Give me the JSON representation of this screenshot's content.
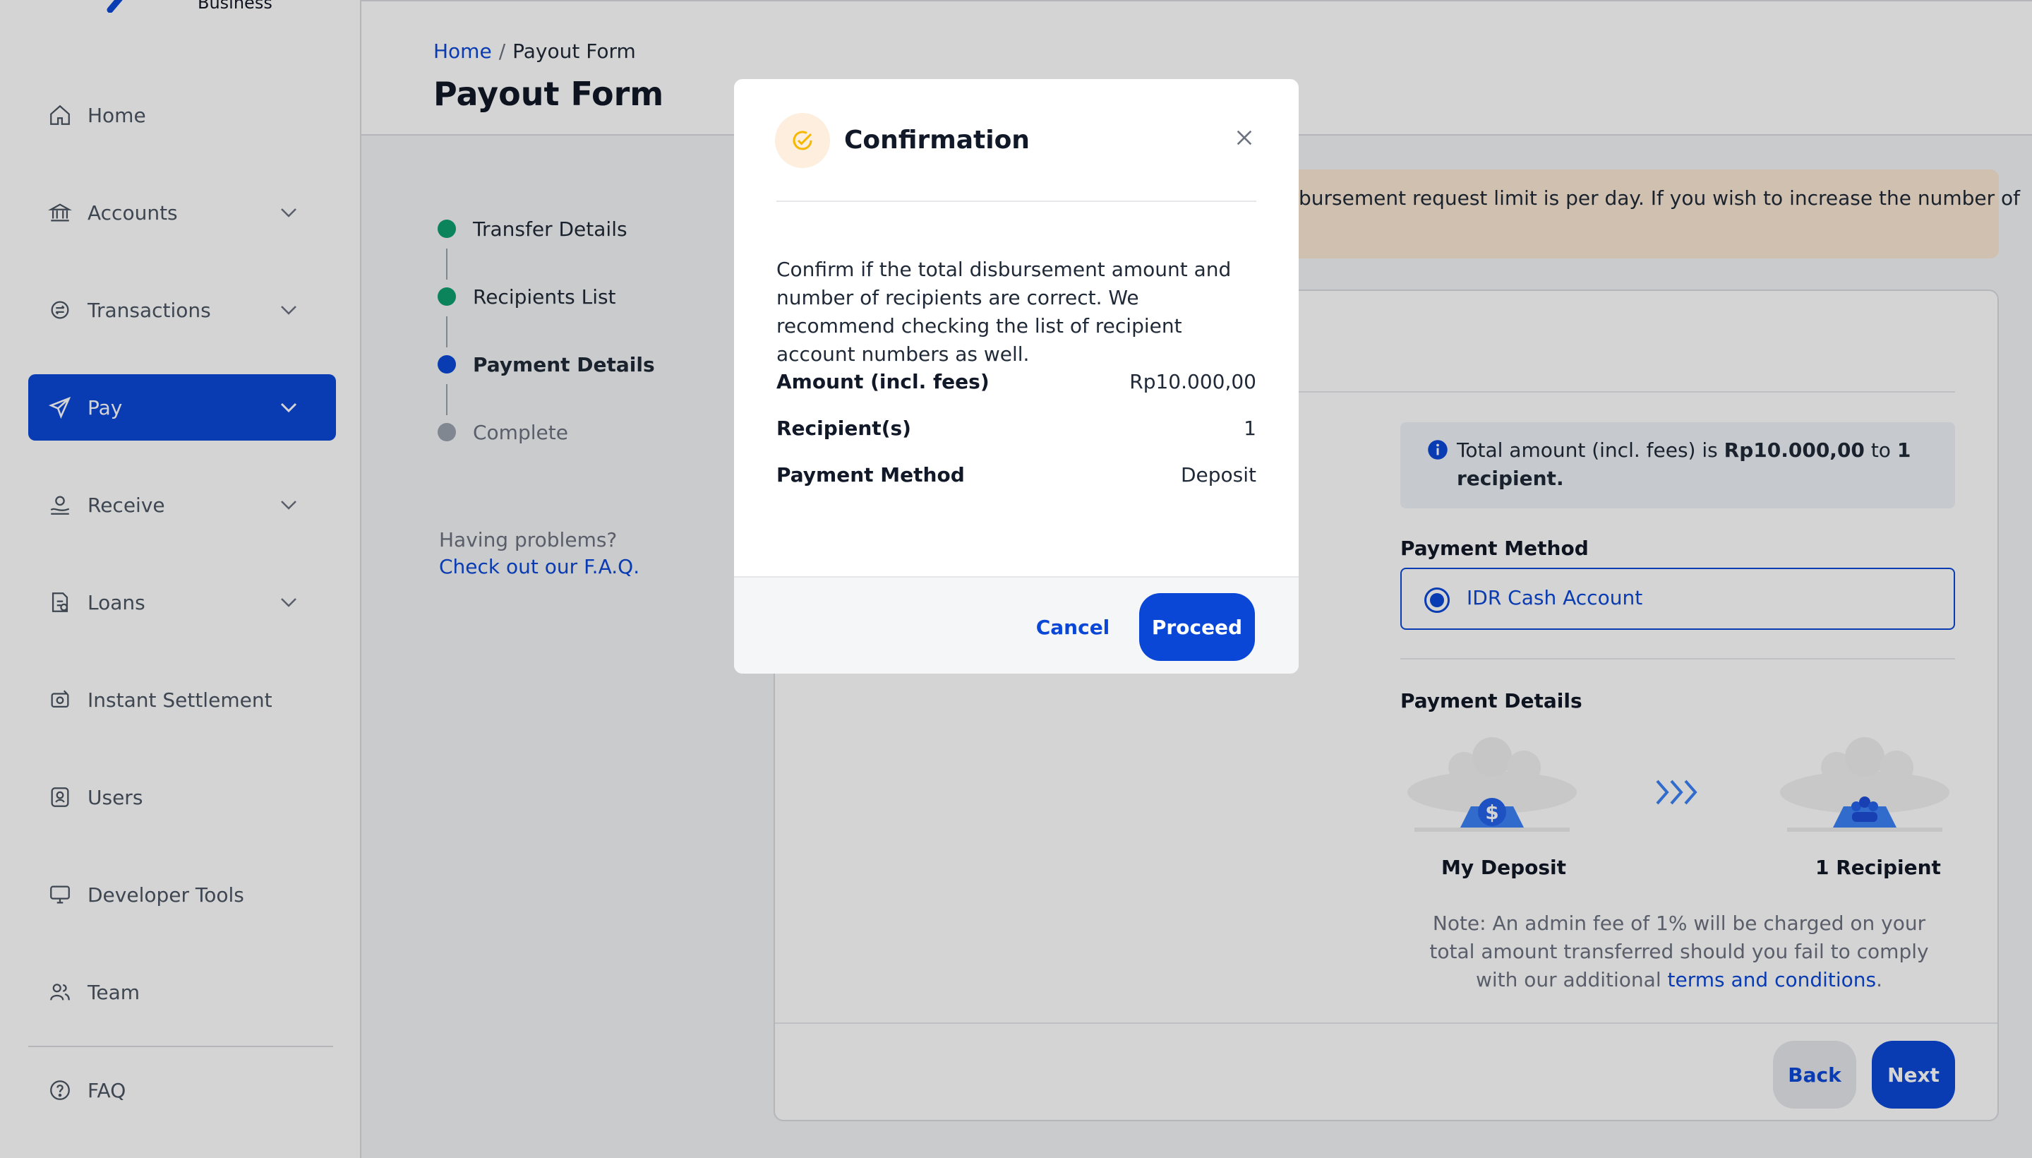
{
  "brand": {
    "subtitle": "Business"
  },
  "sidebar": {
    "items": [
      {
        "label": "Home",
        "icon": "home-icon"
      },
      {
        "label": "Accounts",
        "icon": "bank-icon",
        "expandable": true
      },
      {
        "label": "Transactions",
        "icon": "transactions-icon",
        "expandable": true
      },
      {
        "label": "Pay",
        "icon": "send-icon",
        "expandable": true,
        "active": true
      },
      {
        "label": "Receive",
        "icon": "receive-icon",
        "expandable": true
      },
      {
        "label": "Loans",
        "icon": "loans-icon",
        "expandable": true
      },
      {
        "label": "Instant Settlement",
        "icon": "settlement-icon"
      },
      {
        "label": "Users",
        "icon": "user-card-icon"
      },
      {
        "label": "Developer Tools",
        "icon": "monitor-icon"
      },
      {
        "label": "Team",
        "icon": "team-icon"
      },
      {
        "label": "FAQ",
        "icon": "help-circle-icon"
      }
    ]
  },
  "header": {
    "breadcrumb": {
      "home": "Home",
      "separator": "/",
      "current": "Payout Form"
    },
    "title": "Payout Form"
  },
  "stepper": {
    "steps": [
      {
        "label": "Transfer Details",
        "status": "done"
      },
      {
        "label": "Recipients List",
        "status": "done"
      },
      {
        "label": "Payment Details",
        "status": "current"
      },
      {
        "label": "Complete",
        "status": "pending"
      }
    ],
    "help_text": "Having problems?",
    "help_link": "Check out our F.A.Q."
  },
  "banner": {
    "text": "bursement request limit is per day. If you wish to increase the number of"
  },
  "main": {
    "info_prefix": "Total amount (incl. fees) is ",
    "info_amount": "Rp10.000,00",
    "info_mid": " to ",
    "info_count": "1 recipient.",
    "payment_method_label": "Payment Method",
    "payment_method_option": "IDR Cash Account",
    "payment_details_label": "Payment Details",
    "from_caption": "My Deposit",
    "to_caption": "1 Recipient",
    "note_text": "Note: An admin fee of 1% will be charged on your total amount transferred should you fail to comply with our additional ",
    "note_link": "terms and conditions",
    "note_end": ".",
    "back_label": "Back",
    "next_label": "Next"
  },
  "modal": {
    "title": "Confirmation",
    "description": "Confirm if the total disbursement amount and number of recipients are correct. We recommend checking the list of recipient account numbers as well.",
    "summary": [
      {
        "label": "Amount (incl. fees)",
        "value": "Rp10.000,00"
      },
      {
        "label": "Recipient(s)",
        "value": "1"
      },
      {
        "label": "Payment Method",
        "value": "Deposit"
      }
    ],
    "cancel_label": "Cancel",
    "proceed_label": "Proceed"
  },
  "colors": {
    "primary": "#0b47d6",
    "step_done": "#0e9f6e",
    "step_pending": "#9ca3af",
    "banner_bg": "#fbe7d4",
    "badge_icon": "#f5b700"
  }
}
